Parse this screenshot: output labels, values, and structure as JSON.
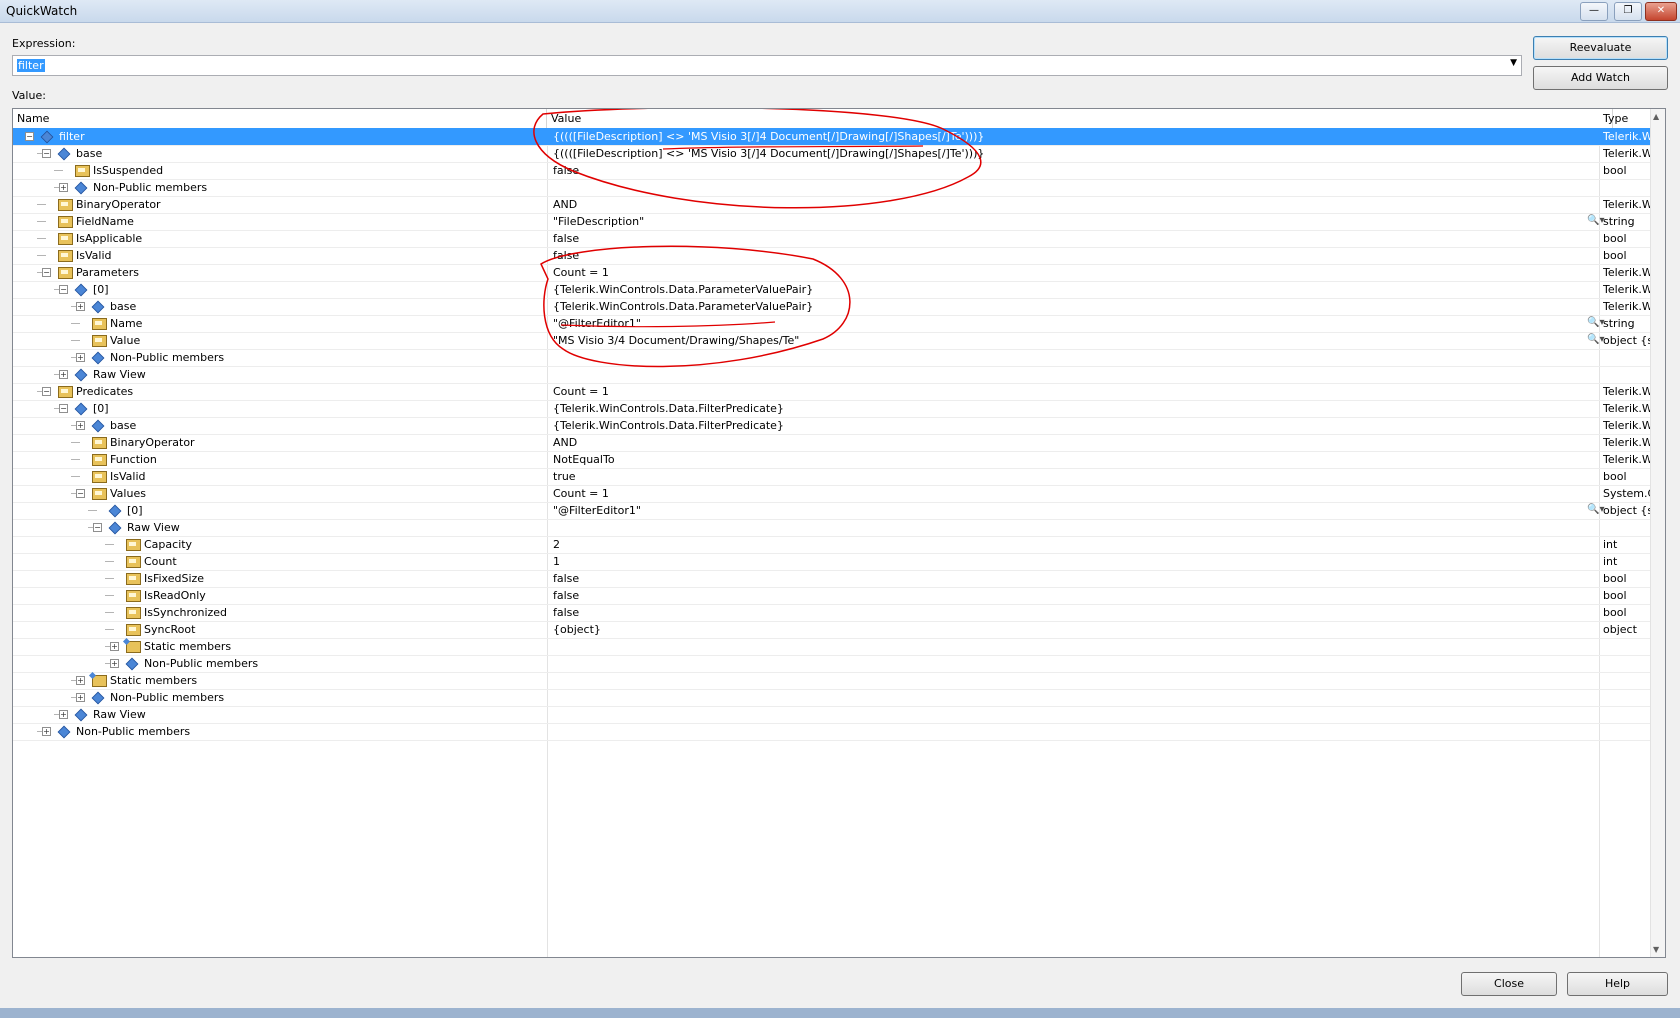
{
  "window": {
    "title": "QuickWatch",
    "controls": {
      "minimize": "—",
      "restore": "❐",
      "close": "✕"
    }
  },
  "expression": {
    "label": "Expression:",
    "value": "filter",
    "dropdown_icon": "chevron-down-icon"
  },
  "value_label": "Value:",
  "buttons": {
    "reevaluate": "Reevaluate",
    "add_watch": "Add Watch",
    "close": "Close",
    "help": "Help"
  },
  "grid": {
    "columns": {
      "name": "Name",
      "value": "Value",
      "type": "Type"
    },
    "rows": [
      {
        "name": "filter",
        "value": "{((([FileDescription] <> 'MS Visio 3[/]4 Document[/]Drawing[/]Shapes[/]Te')))}",
        "type": "Telerik.W",
        "depth": 0,
        "exp": "minus",
        "icon": "field",
        "selected": true
      },
      {
        "name": "base",
        "value": "{((([FileDescription] <> 'MS Visio 3[/]4 Document[/]Drawing[/]Shapes[/]Te')))}",
        "type": "Telerik.W",
        "depth": 1,
        "exp": "minus",
        "icon": "field"
      },
      {
        "name": "IsSuspended",
        "value": "false",
        "type": "bool",
        "depth": 2,
        "exp": "",
        "icon": "prop"
      },
      {
        "name": "Non-Public members",
        "value": "",
        "type": "",
        "depth": 2,
        "exp": "plus",
        "icon": "field"
      },
      {
        "name": "BinaryOperator",
        "value": "AND",
        "type": "Telerik.W",
        "depth": 1,
        "exp": "",
        "icon": "prop"
      },
      {
        "name": "FieldName",
        "value": "\"FileDescription\"",
        "type": "string",
        "depth": 1,
        "exp": "",
        "icon": "prop",
        "mag": true
      },
      {
        "name": "IsApplicable",
        "value": "false",
        "type": "bool",
        "depth": 1,
        "exp": "",
        "icon": "prop"
      },
      {
        "name": "IsValid",
        "value": "false",
        "type": "bool",
        "depth": 1,
        "exp": "",
        "icon": "prop"
      },
      {
        "name": "Parameters",
        "value": "Count = 1",
        "type": "Telerik.W",
        "depth": 1,
        "exp": "minus",
        "icon": "prop"
      },
      {
        "name": "[0]",
        "value": "{Telerik.WinControls.Data.ParameterValuePair}",
        "type": "Telerik.W",
        "depth": 2,
        "exp": "minus",
        "icon": "field"
      },
      {
        "name": "base",
        "value": "{Telerik.WinControls.Data.ParameterValuePair}",
        "type": "Telerik.W",
        "depth": 3,
        "exp": "plus",
        "icon": "field"
      },
      {
        "name": "Name",
        "value": "\"@FilterEditor1\"",
        "type": "string",
        "depth": 3,
        "exp": "",
        "icon": "prop",
        "mag": true
      },
      {
        "name": "Value",
        "value": "\"MS Visio 3/4 Document/Drawing/Shapes/Te\"",
        "type": "object {st",
        "depth": 3,
        "exp": "",
        "icon": "prop",
        "mag": true
      },
      {
        "name": "Non-Public members",
        "value": "",
        "type": "",
        "depth": 3,
        "exp": "plus",
        "icon": "field"
      },
      {
        "name": "Raw View",
        "value": "",
        "type": "",
        "depth": 2,
        "exp": "plus",
        "icon": "field"
      },
      {
        "name": "Predicates",
        "value": "Count = 1",
        "type": "Telerik.W",
        "depth": 1,
        "exp": "minus",
        "icon": "prop"
      },
      {
        "name": "[0]",
        "value": "{Telerik.WinControls.Data.FilterPredicate}",
        "type": "Telerik.W",
        "depth": 2,
        "exp": "minus",
        "icon": "field"
      },
      {
        "name": "base",
        "value": "{Telerik.WinControls.Data.FilterPredicate}",
        "type": "Telerik.W",
        "depth": 3,
        "exp": "plus",
        "icon": "field"
      },
      {
        "name": "BinaryOperator",
        "value": "AND",
        "type": "Telerik.W",
        "depth": 3,
        "exp": "",
        "icon": "prop"
      },
      {
        "name": "Function",
        "value": "NotEqualTo",
        "type": "Telerik.W",
        "depth": 3,
        "exp": "",
        "icon": "prop"
      },
      {
        "name": "IsValid",
        "value": "true",
        "type": "bool",
        "depth": 3,
        "exp": "",
        "icon": "prop"
      },
      {
        "name": "Values",
        "value": "Count = 1",
        "type": "System.C",
        "depth": 3,
        "exp": "minus",
        "icon": "prop"
      },
      {
        "name": "[0]",
        "value": "\"@FilterEditor1\"",
        "type": "object {st",
        "depth": 4,
        "exp": "",
        "icon": "field",
        "mag": true
      },
      {
        "name": "Raw View",
        "value": "",
        "type": "",
        "depth": 4,
        "exp": "minus",
        "icon": "field"
      },
      {
        "name": "Capacity",
        "value": "2",
        "type": "int",
        "depth": 5,
        "exp": "",
        "icon": "prop"
      },
      {
        "name": "Count",
        "value": "1",
        "type": "int",
        "depth": 5,
        "exp": "",
        "icon": "prop"
      },
      {
        "name": "IsFixedSize",
        "value": "false",
        "type": "bool",
        "depth": 5,
        "exp": "",
        "icon": "prop"
      },
      {
        "name": "IsReadOnly",
        "value": "false",
        "type": "bool",
        "depth": 5,
        "exp": "",
        "icon": "prop"
      },
      {
        "name": "IsSynchronized",
        "value": "false",
        "type": "bool",
        "depth": 5,
        "exp": "",
        "icon": "prop"
      },
      {
        "name": "SyncRoot",
        "value": "{object}",
        "type": "object",
        "depth": 5,
        "exp": "",
        "icon": "prop"
      },
      {
        "name": "Static members",
        "value": "",
        "type": "",
        "depth": 5,
        "exp": "plus",
        "icon": "stat"
      },
      {
        "name": "Non-Public members",
        "value": "",
        "type": "",
        "depth": 5,
        "exp": "plus",
        "icon": "field"
      },
      {
        "name": "Static members",
        "value": "",
        "type": "",
        "depth": 3,
        "exp": "plus",
        "icon": "stat"
      },
      {
        "name": "Non-Public members",
        "value": "",
        "type": "",
        "depth": 3,
        "exp": "plus",
        "icon": "field"
      },
      {
        "name": "Raw View",
        "value": "",
        "type": "",
        "depth": 2,
        "exp": "plus",
        "icon": "field"
      },
      {
        "name": "Non-Public members",
        "value": "",
        "type": "",
        "depth": 1,
        "exp": "plus",
        "icon": "field"
      }
    ]
  },
  "annotation_color": "#e00000",
  "selection_color": "#3399ff"
}
